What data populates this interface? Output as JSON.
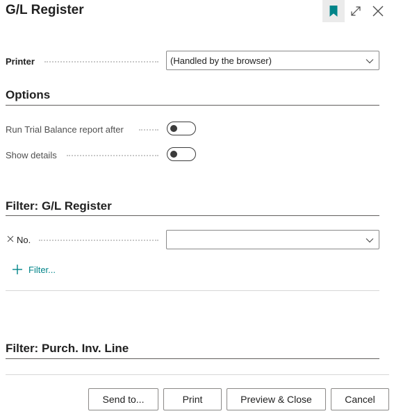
{
  "header": {
    "title": "G/L Register",
    "icons": {
      "bookmark": "bookmark-icon",
      "expand": "expand-icon",
      "close": "close-icon"
    },
    "accent_color": "#008489"
  },
  "printer": {
    "label": "Printer",
    "value": "(Handled by the browser)"
  },
  "options": {
    "title": "Options",
    "fields": [
      {
        "label": "Run Trial Balance report after",
        "checked": false
      },
      {
        "label": "Show details",
        "checked": false
      }
    ]
  },
  "filter_gl": {
    "title": "Filter: G/L Register",
    "fields": [
      {
        "label": "No.",
        "value": ""
      }
    ],
    "add_filter_label": "Filter..."
  },
  "filter_purch": {
    "title": "Filter: Purch. Inv. Line"
  },
  "footer": {
    "send_to": "Send to...",
    "print": "Print",
    "preview_close": "Preview & Close",
    "cancel": "Cancel"
  }
}
